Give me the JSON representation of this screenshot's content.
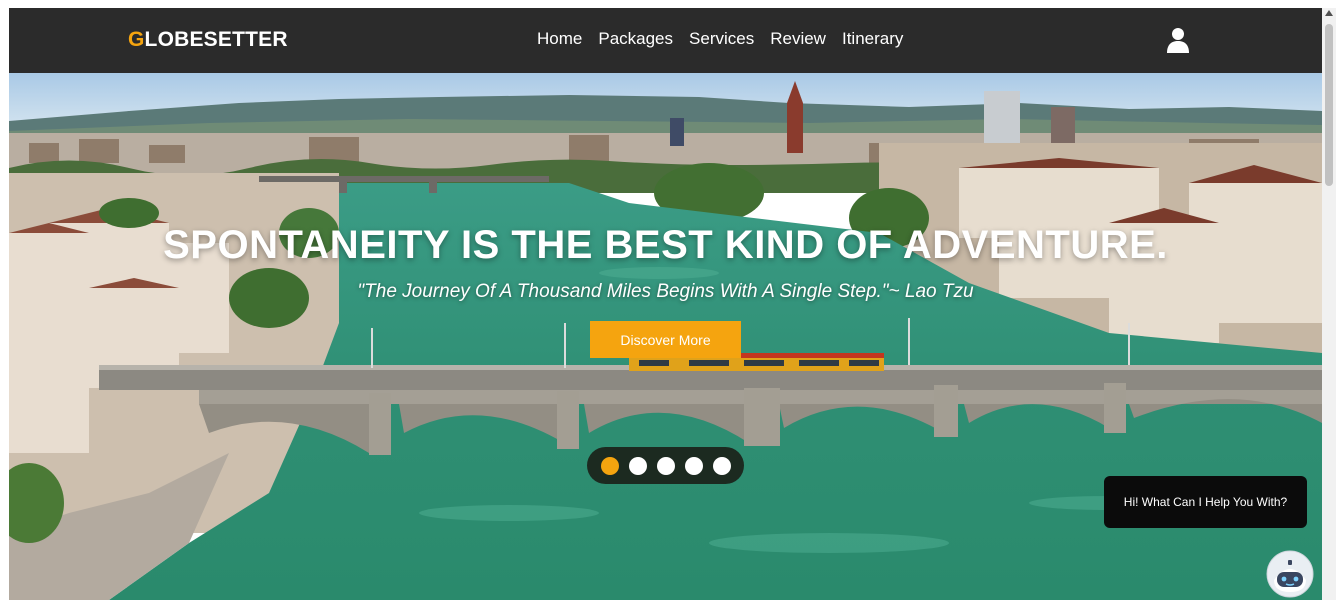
{
  "brand": {
    "first_letter": "G",
    "rest": "LOBESETTER",
    "accent_color": "#f5a40f"
  },
  "nav": {
    "links": [
      "Home",
      "Packages",
      "Services",
      "Review",
      "Itinerary"
    ],
    "user_icon": "user-icon"
  },
  "hero": {
    "title": "SPONTANEITY IS THE BEST KIND OF ADVENTURE.",
    "quote": "\"The Journey Of A Thousand Miles Begins With A Single Step.\"~ Lao Tzu",
    "cta_label": "Discover More",
    "slides_total": 5,
    "active_slide": 1
  },
  "chat": {
    "bubble_text": "Hi! What Can I Help You With?",
    "bot_icon": "robot-icon"
  },
  "colors": {
    "navbar": "#2b2b2b",
    "accent": "#f5a40f",
    "river": "#2f8f74"
  }
}
